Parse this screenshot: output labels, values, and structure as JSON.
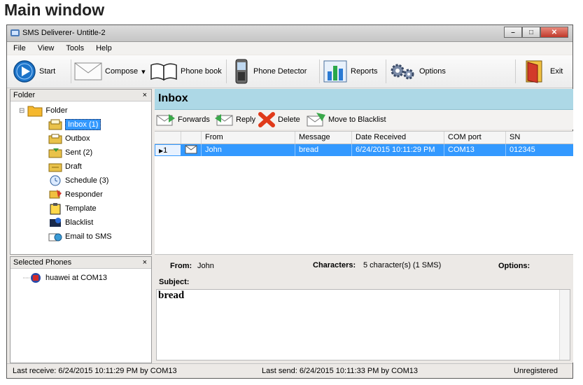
{
  "page_heading": "Main window",
  "window": {
    "title": "SMS Deliverer- Untitle-2",
    "controls": {
      "minimize": "–",
      "maximize": "□",
      "close": "✕"
    }
  },
  "menu": {
    "items": [
      "File",
      "View",
      "Tools",
      "Help"
    ]
  },
  "toolbar": {
    "start": "Start",
    "compose": "Compose",
    "compose_arrow": "▾",
    "phone_book": "Phone book",
    "phone_detector": "Phone Detector",
    "reports": "Reports",
    "options": "Options",
    "exit": "Exit"
  },
  "folder_panel": {
    "title": "Folder",
    "close": "×",
    "root": "Folder",
    "expander": "⊟",
    "items": [
      "Inbox (1)",
      "Outbox",
      "Sent (2)",
      "Draft",
      "Schedule (3)",
      "Responder",
      "Template",
      "Blacklist",
      "Email to SMS"
    ],
    "selected": "Inbox (1)"
  },
  "phones_panel": {
    "title": "Selected Phones",
    "close": "×",
    "items": [
      "huawei at COM13"
    ]
  },
  "inbox": {
    "title": "Inbox",
    "actions": {
      "forwards": "Forwards",
      "reply": "Reply",
      "delete": "Delete",
      "blacklist": "Move to Blacklist"
    },
    "columns": [
      "From",
      "Message",
      "Date Received",
      "COM port",
      "SN"
    ],
    "rows": [
      {
        "index": "1",
        "marker": "▶",
        "from": "John",
        "message": "bread",
        "date": "6/24/2015 10:11:29 PM",
        "com": "COM13",
        "sn": "012345"
      }
    ]
  },
  "detail": {
    "from_label": "From:",
    "from_value": "John",
    "characters_label": "Characters:",
    "characters_value": "5 character(s) (1 SMS)",
    "options_label": "Options:",
    "subject_label": "Subject:",
    "body": "bread"
  },
  "status": {
    "last_receive": "Last receive:  6/24/2015 10:11:29 PM by COM13",
    "last_send": "Last send:  6/24/2015 10:11:33 PM by COM13",
    "registration": "Unregistered"
  },
  "colors": {
    "accent": "#3399ff",
    "inbox_header": "#add8e6",
    "selection": "#3399ff"
  }
}
